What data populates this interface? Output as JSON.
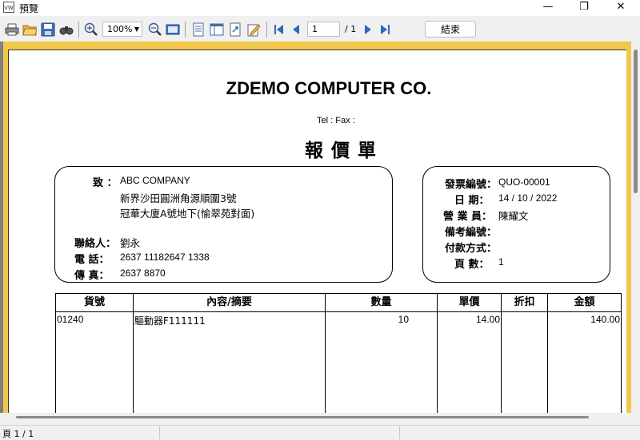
{
  "window": {
    "title": "預覽",
    "app_icon_text": "VW"
  },
  "toolbar": {
    "zoom": "100%",
    "page_current": "1",
    "page_total": "/ 1",
    "close_label": "結束",
    "icons": [
      "print-icon",
      "open-folder-icon",
      "save-icon",
      "find-icon",
      "zoom-in-icon",
      "zoom-out-icon",
      "fit-page-icon",
      "page-setup-icon",
      "columns-icon",
      "export-icon",
      "edit-icon",
      "first-page-icon",
      "prev-page-icon",
      "next-page-icon",
      "last-page-icon"
    ]
  },
  "document": {
    "company": "ZDEMO COMPUTER CO.",
    "tel_fax": "Tel :     Fax :",
    "title": "報價單",
    "customer": {
      "to_label": "致 ：",
      "to_value": "ABC COMPANY",
      "address1": "新界沙田圓洲角源順圍3號",
      "address2": "冠華大廈A號地下(愉翠苑對面)",
      "contact_label": "聯絡人：",
      "contact_value": "劉永",
      "phone_label": "電  話：",
      "phone_value": "2637 11182647 1338",
      "fax_label": "傳  真：",
      "fax_value": "2637 8870"
    },
    "info": {
      "invoice_label": "發票編號：",
      "invoice_value": "QUO-00001",
      "date_label": "日  期：",
      "date_value": "14 / 10 / 2022",
      "sales_label": "營 業 員：",
      "sales_value": "陳耀文",
      "ref_label": "備考編號：",
      "ref_value": "",
      "payment_label": "付款方式：",
      "payment_value": "",
      "page_label": "頁  數：",
      "page_value": "1"
    },
    "table": {
      "headers": [
        "貨號",
        "內容/摘要",
        "數量",
        "單價",
        "折扣",
        "金額"
      ],
      "rows": [
        {
          "item_no": "01240",
          "description": "驅動器F111111",
          "qty": "10",
          "unit_price": "14.00",
          "discount": "",
          "amount": "140.00"
        }
      ]
    }
  },
  "status": {
    "page_text": "頁 1 / 1"
  }
}
